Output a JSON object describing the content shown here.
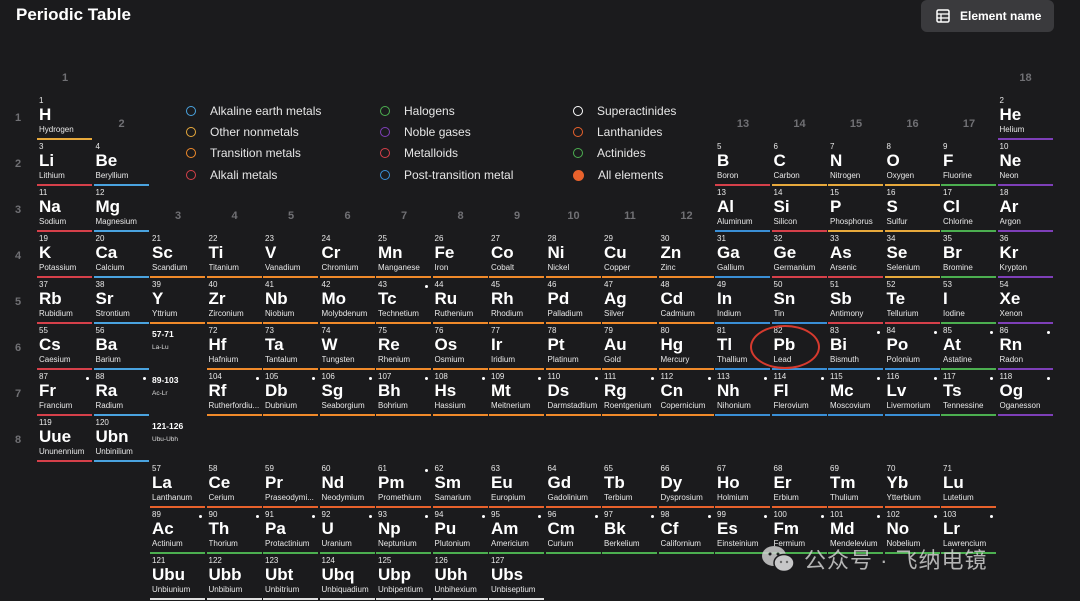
{
  "header": {
    "title": "Periodic Table",
    "element_name_label": "Element name"
  },
  "group_numbers": [
    "1",
    "2",
    "13",
    "14",
    "15",
    "16",
    "17",
    "18",
    "3",
    "4",
    "5",
    "6",
    "7",
    "8",
    "9",
    "10",
    "11",
    "12"
  ],
  "period_numbers": [
    "1",
    "2",
    "3",
    "4",
    "5",
    "6",
    "7",
    "8"
  ],
  "legend": [
    {
      "label": "Alkaline earth metals",
      "color": "#4aa3df",
      "style": "ring"
    },
    {
      "label": "Other nonmetals",
      "color": "#e7a93c",
      "style": "ring"
    },
    {
      "label": "Transition metals",
      "color": "#f08a2a",
      "style": "ring"
    },
    {
      "label": "Alkali metals",
      "color": "#d6404a",
      "style": "ring"
    },
    {
      "label": "Halogens",
      "color": "#4caf50",
      "style": "ring"
    },
    {
      "label": "Noble gases",
      "color": "#7e3fb8",
      "style": "ring"
    },
    {
      "label": "Metalloids",
      "color": "#d6404a",
      "style": "ring"
    },
    {
      "label": "Post-transition metal",
      "color": "#3a8fd6",
      "style": "ring"
    },
    {
      "label": "Superactinides",
      "color": "#ffffff",
      "style": "ring"
    },
    {
      "label": "Lanthanides",
      "color": "#e8622c",
      "style": "ring"
    },
    {
      "label": "Actinides",
      "color": "#4caf50",
      "style": "ring"
    },
    {
      "label": "All elements",
      "color": "#e8622c",
      "style": "fill"
    }
  ],
  "placeholders": [
    {
      "range": "57-71",
      "code": "La-Lu"
    },
    {
      "range": "89-103",
      "code": "Ac-Lr"
    },
    {
      "range": "121-126",
      "code": "Ubu-Ubh"
    }
  ],
  "colors": {
    "alkali": "#d6404a",
    "alkaline": "#4aa3df",
    "transition": "#f08a2a",
    "post": "#3a8fd6",
    "metalloid": "#d6404a",
    "nonmetal": "#e7a93c",
    "halogen": "#4caf50",
    "noble": "#7e3fb8",
    "lanthanide": "#e8622c",
    "actinide": "#4caf50",
    "superactinide": "#e0e0e0",
    "highlight": "#d63a2e"
  },
  "elements": [
    {
      "n": "1",
      "s": "H",
      "name": "Hydrogen",
      "c": "nonmetal",
      "g": 1,
      "p": 1
    },
    {
      "n": "2",
      "s": "He",
      "name": "Helium",
      "c": "noble",
      "g": 18,
      "p": 1
    },
    {
      "n": "3",
      "s": "Li",
      "name": "Lithium",
      "c": "alkali",
      "g": 1,
      "p": 2
    },
    {
      "n": "4",
      "s": "Be",
      "name": "Beryllium",
      "c": "alkaline",
      "g": 2,
      "p": 2
    },
    {
      "n": "5",
      "s": "B",
      "name": "Boron",
      "c": "metalloid",
      "g": 13,
      "p": 2
    },
    {
      "n": "6",
      "s": "C",
      "name": "Carbon",
      "c": "nonmetal",
      "g": 14,
      "p": 2
    },
    {
      "n": "7",
      "s": "N",
      "name": "Nitrogen",
      "c": "nonmetal",
      "g": 15,
      "p": 2
    },
    {
      "n": "8",
      "s": "O",
      "name": "Oxygen",
      "c": "nonmetal",
      "g": 16,
      "p": 2
    },
    {
      "n": "9",
      "s": "F",
      "name": "Fluorine",
      "c": "halogen",
      "g": 17,
      "p": 2
    },
    {
      "n": "10",
      "s": "Ne",
      "name": "Neon",
      "c": "noble",
      "g": 18,
      "p": 2
    },
    {
      "n": "11",
      "s": "Na",
      "name": "Sodium",
      "c": "alkali",
      "g": 1,
      "p": 3
    },
    {
      "n": "12",
      "s": "Mg",
      "name": "Magnesium",
      "c": "alkaline",
      "g": 2,
      "p": 3
    },
    {
      "n": "13",
      "s": "Al",
      "name": "Aluminum",
      "c": "post",
      "g": 13,
      "p": 3
    },
    {
      "n": "14",
      "s": "Si",
      "name": "Silicon",
      "c": "metalloid",
      "g": 14,
      "p": 3
    },
    {
      "n": "15",
      "s": "P",
      "name": "Phosphorus",
      "c": "nonmetal",
      "g": 15,
      "p": 3
    },
    {
      "n": "16",
      "s": "S",
      "name": "Sulfur",
      "c": "nonmetal",
      "g": 16,
      "p": 3
    },
    {
      "n": "17",
      "s": "Cl",
      "name": "Chlorine",
      "c": "halogen",
      "g": 17,
      "p": 3
    },
    {
      "n": "18",
      "s": "Ar",
      "name": "Argon",
      "c": "noble",
      "g": 18,
      "p": 3
    },
    {
      "n": "19",
      "s": "K",
      "name": "Potassium",
      "c": "alkali",
      "g": 1,
      "p": 4
    },
    {
      "n": "20",
      "s": "Ca",
      "name": "Calcium",
      "c": "alkaline",
      "g": 2,
      "p": 4
    },
    {
      "n": "21",
      "s": "Sc",
      "name": "Scandium",
      "c": "transition",
      "g": 3,
      "p": 4
    },
    {
      "n": "22",
      "s": "Ti",
      "name": "Titanium",
      "c": "transition",
      "g": 4,
      "p": 4
    },
    {
      "n": "23",
      "s": "V",
      "name": "Vanadium",
      "c": "transition",
      "g": 5,
      "p": 4
    },
    {
      "n": "24",
      "s": "Cr",
      "name": "Chromium",
      "c": "transition",
      "g": 6,
      "p": 4
    },
    {
      "n": "25",
      "s": "Mn",
      "name": "Manganese",
      "c": "transition",
      "g": 7,
      "p": 4
    },
    {
      "n": "26",
      "s": "Fe",
      "name": "Iron",
      "c": "transition",
      "g": 8,
      "p": 4
    },
    {
      "n": "27",
      "s": "Co",
      "name": "Cobalt",
      "c": "transition",
      "g": 9,
      "p": 4
    },
    {
      "n": "28",
      "s": "Ni",
      "name": "Nickel",
      "c": "transition",
      "g": 10,
      "p": 4
    },
    {
      "n": "29",
      "s": "Cu",
      "name": "Copper",
      "c": "transition",
      "g": 11,
      "p": 4
    },
    {
      "n": "30",
      "s": "Zn",
      "name": "Zinc",
      "c": "transition",
      "g": 12,
      "p": 4
    },
    {
      "n": "31",
      "s": "Ga",
      "name": "Gallium",
      "c": "post",
      "g": 13,
      "p": 4
    },
    {
      "n": "32",
      "s": "Ge",
      "name": "Germanium",
      "c": "metalloid",
      "g": 14,
      "p": 4
    },
    {
      "n": "33",
      "s": "As",
      "name": "Arsenic",
      "c": "metalloid",
      "g": 15,
      "p": 4
    },
    {
      "n": "34",
      "s": "Se",
      "name": "Selenium",
      "c": "nonmetal",
      "g": 16,
      "p": 4
    },
    {
      "n": "35",
      "s": "Br",
      "name": "Bromine",
      "c": "halogen",
      "g": 17,
      "p": 4
    },
    {
      "n": "36",
      "s": "Kr",
      "name": "Krypton",
      "c": "noble",
      "g": 18,
      "p": 4
    },
    {
      "n": "37",
      "s": "Rb",
      "name": "Rubidium",
      "c": "alkali",
      "g": 1,
      "p": 5
    },
    {
      "n": "38",
      "s": "Sr",
      "name": "Strontium",
      "c": "alkaline",
      "g": 2,
      "p": 5
    },
    {
      "n": "39",
      "s": "Y",
      "name": "Yttrium",
      "c": "transition",
      "g": 3,
      "p": 5
    },
    {
      "n": "40",
      "s": "Zr",
      "name": "Zirconium",
      "c": "transition",
      "g": 4,
      "p": 5
    },
    {
      "n": "41",
      "s": "Nb",
      "name": "Niobium",
      "c": "transition",
      "g": 5,
      "p": 5
    },
    {
      "n": "42",
      "s": "Mo",
      "name": "Molybdenum",
      "c": "transition",
      "g": 6,
      "p": 5
    },
    {
      "n": "43",
      "s": "Tc",
      "name": "Technetium",
      "c": "transition",
      "g": 7,
      "p": 5,
      "dot": true
    },
    {
      "n": "44",
      "s": "Ru",
      "name": "Ruthenium",
      "c": "transition",
      "g": 8,
      "p": 5
    },
    {
      "n": "45",
      "s": "Rh",
      "name": "Rhodium",
      "c": "transition",
      "g": 9,
      "p": 5
    },
    {
      "n": "46",
      "s": "Pd",
      "name": "Palladium",
      "c": "transition",
      "g": 10,
      "p": 5
    },
    {
      "n": "47",
      "s": "Ag",
      "name": "Silver",
      "c": "transition",
      "g": 11,
      "p": 5
    },
    {
      "n": "48",
      "s": "Cd",
      "name": "Cadmium",
      "c": "transition",
      "g": 12,
      "p": 5
    },
    {
      "n": "49",
      "s": "In",
      "name": "Indium",
      "c": "post",
      "g": 13,
      "p": 5
    },
    {
      "n": "50",
      "s": "Sn",
      "name": "Tin",
      "c": "post",
      "g": 14,
      "p": 5
    },
    {
      "n": "51",
      "s": "Sb",
      "name": "Antimony",
      "c": "metalloid",
      "g": 15,
      "p": 5
    },
    {
      "n": "52",
      "s": "Te",
      "name": "Tellurium",
      "c": "metalloid",
      "g": 16,
      "p": 5
    },
    {
      "n": "53",
      "s": "I",
      "name": "Iodine",
      "c": "halogen",
      "g": 17,
      "p": 5
    },
    {
      "n": "54",
      "s": "Xe",
      "name": "Xenon",
      "c": "noble",
      "g": 18,
      "p": 5
    },
    {
      "n": "55",
      "s": "Cs",
      "name": "Caesium",
      "c": "alkali",
      "g": 1,
      "p": 6
    },
    {
      "n": "56",
      "s": "Ba",
      "name": "Barium",
      "c": "alkaline",
      "g": 2,
      "p": 6
    },
    {
      "n": "72",
      "s": "Hf",
      "name": "Hafnium",
      "c": "transition",
      "g": 4,
      "p": 6
    },
    {
      "n": "73",
      "s": "Ta",
      "name": "Tantalum",
      "c": "transition",
      "g": 5,
      "p": 6
    },
    {
      "n": "74",
      "s": "W",
      "name": "Tungsten",
      "c": "transition",
      "g": 6,
      "p": 6
    },
    {
      "n": "75",
      "s": "Re",
      "name": "Rhenium",
      "c": "transition",
      "g": 7,
      "p": 6
    },
    {
      "n": "76",
      "s": "Os",
      "name": "Osmium",
      "c": "transition",
      "g": 8,
      "p": 6
    },
    {
      "n": "77",
      "s": "Ir",
      "name": "Iridium",
      "c": "transition",
      "g": 9,
      "p": 6
    },
    {
      "n": "78",
      "s": "Pt",
      "name": "Platinum",
      "c": "transition",
      "g": 10,
      "p": 6
    },
    {
      "n": "79",
      "s": "Au",
      "name": "Gold",
      "c": "transition",
      "g": 11,
      "p": 6
    },
    {
      "n": "80",
      "s": "Hg",
      "name": "Mercury",
      "c": "transition",
      "g": 12,
      "p": 6
    },
    {
      "n": "81",
      "s": "Tl",
      "name": "Thallium",
      "c": "post",
      "g": 13,
      "p": 6
    },
    {
      "n": "82",
      "s": "Pb",
      "name": "Lead",
      "c": "post",
      "g": 14,
      "p": 6
    },
    {
      "n": "83",
      "s": "Bi",
      "name": "Bismuth",
      "c": "post",
      "g": 15,
      "p": 6,
      "dot": true
    },
    {
      "n": "84",
      "s": "Po",
      "name": "Polonium",
      "c": "post",
      "g": 16,
      "p": 6,
      "dot": true
    },
    {
      "n": "85",
      "s": "At",
      "name": "Astatine",
      "c": "halogen",
      "g": 17,
      "p": 6,
      "dot": true
    },
    {
      "n": "86",
      "s": "Rn",
      "name": "Radon",
      "c": "noble",
      "g": 18,
      "p": 6,
      "dot": true
    },
    {
      "n": "87",
      "s": "Fr",
      "name": "Francium",
      "c": "alkali",
      "g": 1,
      "p": 7,
      "dot": true
    },
    {
      "n": "88",
      "s": "Ra",
      "name": "Radium",
      "c": "alkaline",
      "g": 2,
      "p": 7,
      "dot": true
    },
    {
      "n": "104",
      "s": "Rf",
      "name": "Rutherfordiu...",
      "c": "transition",
      "g": 4,
      "p": 7,
      "dot": true
    },
    {
      "n": "105",
      "s": "Db",
      "name": "Dubnium",
      "c": "transition",
      "g": 5,
      "p": 7,
      "dot": true
    },
    {
      "n": "106",
      "s": "Sg",
      "name": "Seaborgium",
      "c": "transition",
      "g": 6,
      "p": 7,
      "dot": true
    },
    {
      "n": "107",
      "s": "Bh",
      "name": "Bohrium",
      "c": "transition",
      "g": 7,
      "p": 7,
      "dot": true
    },
    {
      "n": "108",
      "s": "Hs",
      "name": "Hassium",
      "c": "transition",
      "g": 8,
      "p": 7,
      "dot": true
    },
    {
      "n": "109",
      "s": "Mt",
      "name": "Meitnerium",
      "c": "transition",
      "g": 9,
      "p": 7,
      "dot": true
    },
    {
      "n": "110",
      "s": "Ds",
      "name": "Darmstadtium",
      "c": "transition",
      "g": 10,
      "p": 7,
      "dot": true
    },
    {
      "n": "111",
      "s": "Rg",
      "name": "Roentgenium",
      "c": "transition",
      "g": 11,
      "p": 7,
      "dot": true
    },
    {
      "n": "112",
      "s": "Cn",
      "name": "Copernicium",
      "c": "transition",
      "g": 12,
      "p": 7,
      "dot": true
    },
    {
      "n": "113",
      "s": "Nh",
      "name": "Nihonium",
      "c": "post",
      "g": 13,
      "p": 7,
      "dot": true
    },
    {
      "n": "114",
      "s": "Fl",
      "name": "Flerovium",
      "c": "post",
      "g": 14,
      "p": 7,
      "dot": true
    },
    {
      "n": "115",
      "s": "Mc",
      "name": "Moscovium",
      "c": "post",
      "g": 15,
      "p": 7,
      "dot": true
    },
    {
      "n": "116",
      "s": "Lv",
      "name": "Livermorium",
      "c": "post",
      "g": 16,
      "p": 7,
      "dot": true
    },
    {
      "n": "117",
      "s": "Ts",
      "name": "Tennessine",
      "c": "halogen",
      "g": 17,
      "p": 7,
      "dot": true
    },
    {
      "n": "118",
      "s": "Og",
      "name": "Oganesson",
      "c": "noble",
      "g": 18,
      "p": 7,
      "dot": true
    },
    {
      "n": "119",
      "s": "Uue",
      "name": "Ununennium",
      "c": "alkali",
      "g": 1,
      "p": 8
    },
    {
      "n": "120",
      "s": "Ubn",
      "name": "Unbinilium",
      "c": "alkaline",
      "g": 2,
      "p": 8
    }
  ],
  "lanthanides": [
    {
      "n": "57",
      "s": "La",
      "name": "Lanthanum"
    },
    {
      "n": "58",
      "s": "Ce",
      "name": "Cerium"
    },
    {
      "n": "59",
      "s": "Pr",
      "name": "Praseodymi..."
    },
    {
      "n": "60",
      "s": "Nd",
      "name": "Neodymium"
    },
    {
      "n": "61",
      "s": "Pm",
      "name": "Promethium",
      "dot": true
    },
    {
      "n": "62",
      "s": "Sm",
      "name": "Samarium"
    },
    {
      "n": "63",
      "s": "Eu",
      "name": "Europium"
    },
    {
      "n": "64",
      "s": "Gd",
      "name": "Gadolinium"
    },
    {
      "n": "65",
      "s": "Tb",
      "name": "Terbium"
    },
    {
      "n": "66",
      "s": "Dy",
      "name": "Dysprosium"
    },
    {
      "n": "67",
      "s": "Ho",
      "name": "Holmium"
    },
    {
      "n": "68",
      "s": "Er",
      "name": "Erbium"
    },
    {
      "n": "69",
      "s": "Tm",
      "name": "Thulium"
    },
    {
      "n": "70",
      "s": "Yb",
      "name": "Ytterbium"
    },
    {
      "n": "71",
      "s": "Lu",
      "name": "Lutetium"
    }
  ],
  "actinides": [
    {
      "n": "89",
      "s": "Ac",
      "name": "Actinium",
      "dot": true
    },
    {
      "n": "90",
      "s": "Th",
      "name": "Thorium",
      "dot": true
    },
    {
      "n": "91",
      "s": "Pa",
      "name": "Protactinium",
      "dot": true
    },
    {
      "n": "92",
      "s": "U",
      "name": "Uranium",
      "dot": true
    },
    {
      "n": "93",
      "s": "Np",
      "name": "Neptunium",
      "dot": true
    },
    {
      "n": "94",
      "s": "Pu",
      "name": "Plutonium",
      "dot": true
    },
    {
      "n": "95",
      "s": "Am",
      "name": "Americium",
      "dot": true
    },
    {
      "n": "96",
      "s": "Cm",
      "name": "Curium",
      "dot": true
    },
    {
      "n": "97",
      "s": "Bk",
      "name": "Berkelium",
      "dot": true
    },
    {
      "n": "98",
      "s": "Cf",
      "name": "Californium",
      "dot": true
    },
    {
      "n": "99",
      "s": "Es",
      "name": "Einsteinium",
      "dot": true
    },
    {
      "n": "100",
      "s": "Fm",
      "name": "Fermium",
      "dot": true
    },
    {
      "n": "101",
      "s": "Md",
      "name": "Mendelevium",
      "dot": true
    },
    {
      "n": "102",
      "s": "No",
      "name": "Nobelium",
      "dot": true
    },
    {
      "n": "103",
      "s": "Lr",
      "name": "Lawrencium",
      "dot": true
    }
  ],
  "superactinides": [
    {
      "n": "121",
      "s": "Ubu",
      "name": "Unbiunium"
    },
    {
      "n": "122",
      "s": "Ubb",
      "name": "Unbibium"
    },
    {
      "n": "123",
      "s": "Ubt",
      "name": "Unbitrium"
    },
    {
      "n": "124",
      "s": "Ubq",
      "name": "Unbiquadium"
    },
    {
      "n": "125",
      "s": "Ubp",
      "name": "Unbipentium"
    },
    {
      "n": "126",
      "s": "Ubh",
      "name": "Unbihexium"
    },
    {
      "n": "127",
      "s": "Ubs",
      "name": "Unbiseptium"
    }
  ],
  "watermark": {
    "text": "公众号 · 飞纳电镜",
    "icon": "wechat-icon"
  }
}
